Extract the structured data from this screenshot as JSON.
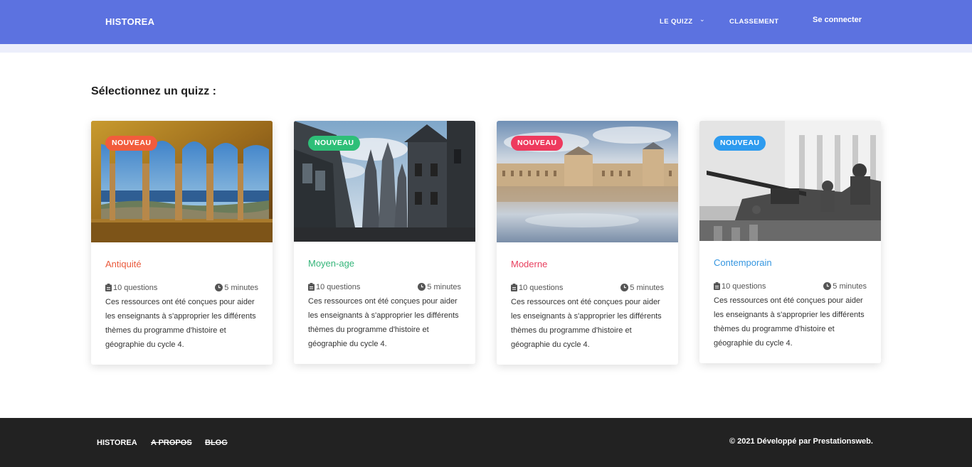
{
  "nav": {
    "brand": "HISTOREA",
    "quizz": "LE QUIZZ",
    "caret": "⌄",
    "classement": "CLASSEMENT",
    "login": "Se connecter",
    "color": "#5c72e0"
  },
  "main": {
    "title": "Sélectionnez un quizz :"
  },
  "cards": [
    {
      "badge": "NOUVEAU",
      "badge_color": "#f25c3c",
      "title": "Antiquité",
      "title_color": "#ea5a3c",
      "questions": "10 questions",
      "duration": "5 minutes",
      "description": "Ces ressources ont été conçues pour aider les enseignants à s'approprier les différents thèmes du programme d'histoire et géographie du cycle 4."
    },
    {
      "badge": "NOUVEAU",
      "badge_color": "#2ebf78",
      "title": "Moyen-age",
      "title_color": "#35b57a",
      "questions": "10 questions",
      "duration": "5 minutes",
      "description": "Ces ressources ont été conçues pour aider les enseignants à s'approprier les différents thèmes du programme d'histoire et géographie du cycle 4."
    },
    {
      "badge": "NOUVEAU",
      "badge_color": "#ee3a5e",
      "title": "Moderne",
      "title_color": "#e8405f",
      "questions": "10 questions",
      "duration": "5 minutes",
      "description": "Ces ressources ont été conçues pour aider les enseignants à s'approprier les différents thèmes du programme d'histoire et géographie du cycle 4."
    },
    {
      "badge": "NOUVEAU",
      "badge_color": "#2d9bef",
      "title": "Contemporain",
      "title_color": "#3596e0",
      "questions": "10 questions",
      "duration": "5 minutes",
      "description": "Ces ressources ont été conçues pour aider les enseignants à s'approprier les différents thèmes du programme d'histoire et géographie du cycle 4."
    }
  ],
  "footer": {
    "brand": "HISTOREA",
    "about": "A PROPOS",
    "blog": "BLOG",
    "copyright": "© 2021 Développé par Prestationsweb."
  },
  "icons": {
    "questions": "clipboard-icon",
    "duration": "clock-icon"
  }
}
